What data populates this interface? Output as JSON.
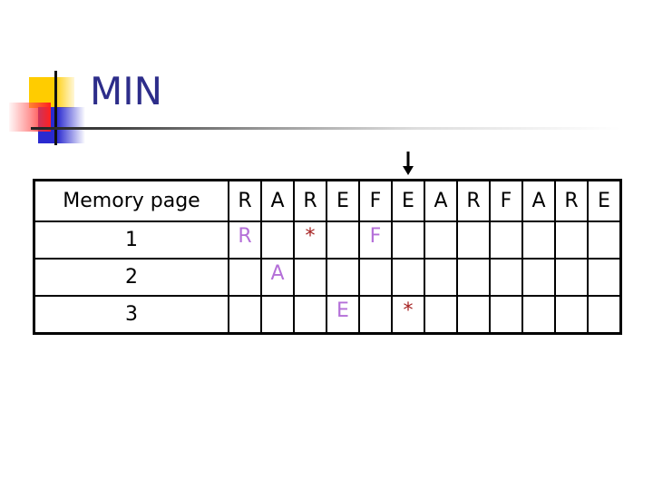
{
  "slide": {
    "title": "MIN",
    "title_color": "#2d2d8a"
  },
  "table": {
    "header_label": "Memory page",
    "reference_string": [
      "R",
      "A",
      "R",
      "E",
      "F",
      "E",
      "A",
      "R",
      "F",
      "A",
      "R",
      "E"
    ],
    "current_position_marker": {
      "icon": "down-arrow-icon",
      "column_index": 5
    },
    "rows": [
      {
        "label": "1",
        "cells": [
          "R",
          "",
          "*",
          "",
          "F",
          "",
          "",
          "",
          "",
          "",
          "",
          ""
        ]
      },
      {
        "label": "2",
        "cells": [
          "",
          "A",
          "",
          "",
          "",
          "",
          "",
          "",
          "",
          "",
          "",
          ""
        ]
      },
      {
        "label": "3",
        "cells": [
          "",
          "",
          "",
          "E",
          "",
          "*",
          "",
          "",
          "",
          "",
          "",
          ""
        ]
      }
    ],
    "colors": {
      "loaded_page": "#b46fd8",
      "hit_mark": "#a52121"
    }
  }
}
